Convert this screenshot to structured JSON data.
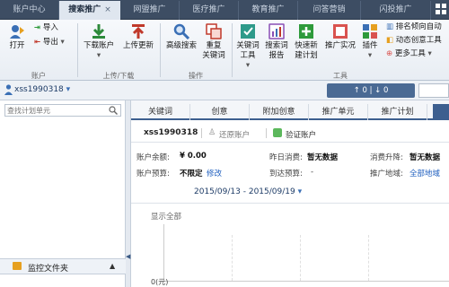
{
  "tabs": [
    {
      "label": "账户中心",
      "active": false
    },
    {
      "label": "搜索推广",
      "active": true
    },
    {
      "label": "网盟推广",
      "active": false
    },
    {
      "label": "医疗推广",
      "active": false
    },
    {
      "label": "教育推广",
      "active": false
    },
    {
      "label": "问答营销",
      "active": false
    },
    {
      "label": "闪投推广",
      "active": false
    }
  ],
  "tab_close": "×",
  "ribbon": {
    "open": "打开",
    "import": "导入",
    "export": "导出",
    "download_account": "下载账户",
    "upload_update": "上传更新",
    "advanced_search": "高级搜索",
    "duplicate_keywords": [
      "重复",
      "关键词"
    ],
    "keyword_tool": [
      "关键词",
      "工具"
    ],
    "search_word_report": [
      "搜索词",
      "报告"
    ],
    "quick_new_plan": [
      "快速新",
      "建计划"
    ],
    "promo_practical": "推广实况",
    "plugin": "插件",
    "side_items": [
      "排名倾向自动",
      "动态创意工具",
      "更多工具"
    ],
    "groups": [
      "账户",
      "上传/下载",
      "操作",
      "工具"
    ]
  },
  "account_bar": {
    "account": "xss1990318",
    "up": "0",
    "down": "0",
    "up_arrow": "↑",
    "down_arrow": "↓",
    "divider": "|"
  },
  "left_panel": {
    "search_placeholder": "查找计划单元",
    "monitor_label": "监控文件夹"
  },
  "main": {
    "tabs": [
      "关键词",
      "创意",
      "附加创意",
      "推广单元",
      "推广计划"
    ],
    "account": "xss1990318",
    "restore": "还原账户",
    "verify": "验证账户",
    "balance_label": "账户余额:",
    "balance": "¥ 0.00",
    "budget_label": "账户预算:",
    "budget": "不限定",
    "budget_edit": "修改",
    "yesterday_label": "昨日消费:",
    "yesterday": "暂无数据",
    "reach_label": "到达预算:",
    "reach": "-",
    "trend_label": "消费升降:",
    "trend": "暂无数据",
    "region_label": "推广地域:",
    "region": "全部地域",
    "date_range": "2015/09/13 - 2015/09/19",
    "show_all": "显示全部",
    "y0": "0(元)",
    "arrow_left": "◀"
  }
}
